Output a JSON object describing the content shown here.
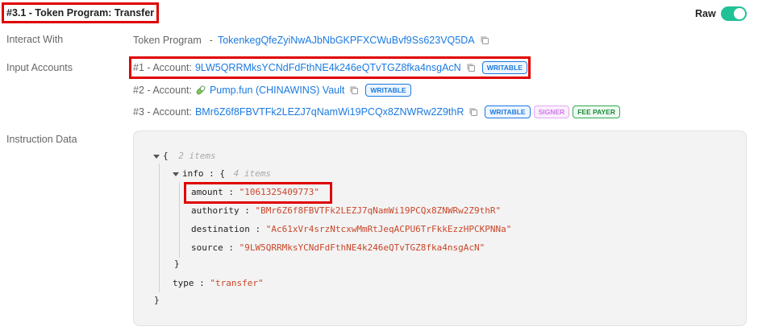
{
  "header": {
    "title": "#3.1 - Token Program: Transfer",
    "raw_label": "Raw",
    "raw_enabled": true
  },
  "interact_with": {
    "label": "Interact With",
    "program_name": "Token Program",
    "separator": "-",
    "program_address": "TokenkegQfeZyiNwAJbNbGKPFXCWuBvf9Ss623VQ5DA"
  },
  "input_accounts": {
    "label": "Input Accounts",
    "accounts": [
      {
        "prefix": "#1 - Account:",
        "address": "9LW5QRRMksYCNdFdFthNE4k246eQTvTGZ8fka4nsgAcN",
        "badges": [
          "WRITABLE"
        ]
      },
      {
        "prefix": "#2 - Account:",
        "icon": "pill-icon",
        "address": "Pump.fun (CHINAWINS) Vault",
        "badges": [
          "WRITABLE"
        ]
      },
      {
        "prefix": "#3 - Account:",
        "address": "BMr6Z6f8FBVTFk2LEZJ7qNamWi19PCQx8ZNWRw2Z9thR",
        "badges": [
          "WRITABLE",
          "SIGNER",
          "FEE PAYER"
        ]
      }
    ]
  },
  "instruction_data": {
    "label": "Instruction Data",
    "root_open": "{",
    "root_meta": "2 items",
    "info_key": "info",
    "info_meta": "4 items",
    "colon": ":",
    "open_brace": "{",
    "close_brace": "}",
    "fields": [
      {
        "key": "amount",
        "value": "\"1061325409773\""
      },
      {
        "key": "authority",
        "value": "\"BMr6Z6f8FBVTFk2LEZJ7qNamWi19PCQx8ZNWRw2Z9thR\""
      },
      {
        "key": "destination",
        "value": "\"Ac61xVr4srzNtcxwMmRtJeqACPU6TrFkkEzzHPCKPNNa\""
      },
      {
        "key": "source",
        "value": "\"9LW5QRRMksYCNdFdFthNE4k246eQTvTGZ8fka4nsgAcN\""
      }
    ],
    "type_key": "type",
    "type_value": "\"transfer\""
  },
  "colors": {
    "link": "#1b7ae0",
    "toggle": "#21c196",
    "highlight": "#e00000",
    "string": "#c9472a"
  }
}
